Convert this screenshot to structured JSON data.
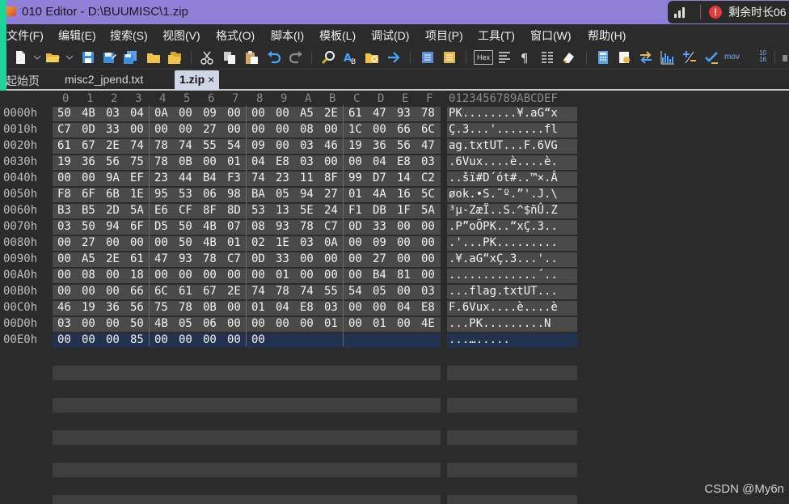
{
  "window": {
    "title": "010 Editor - D:\\BUUMISC\\1.zip",
    "timer_text": "剩余时长06"
  },
  "menu": [
    "文件(F)",
    "编辑(E)",
    "搜索(S)",
    "视图(V)",
    "格式(O)",
    "脚本(I)",
    "模板(L)",
    "调试(D)",
    "项目(P)",
    "工具(T)",
    "窗口(W)",
    "帮助(H)"
  ],
  "toolbar": {
    "hex_label": "Hex",
    "mov_label": "mov",
    "num_label": "10 16",
    "icons": [
      "new-file-icon",
      "open-folder-icon",
      "save-icon",
      "save-as-icon",
      "save-all-icon",
      "open-folder-icon-2",
      "folder-icon",
      "cut-icon",
      "copy-icon",
      "paste-icon",
      "undo-icon",
      "redo-icon",
      "find-icon",
      "replace-icon",
      "find-in-files-icon",
      "goto-icon",
      "bookmark-icon",
      "highlight-icon",
      "hex-view-icon",
      "text-format-icon",
      "pilcrow-icon",
      "columns-icon",
      "eraser-icon",
      "calculator-icon",
      "template-icon",
      "swap-icon",
      "histogram-icon",
      "plus-minus-icon",
      "checksum-icon",
      "mov-icon",
      "base-convert-icon"
    ]
  },
  "tabs": [
    {
      "label": "起始页",
      "active": false
    },
    {
      "label": "misc2_jpend.txt",
      "active": false
    },
    {
      "label": "1.zip",
      "active": true,
      "close": "×"
    }
  ],
  "hex_editor": {
    "column_headers": [
      "0",
      "1",
      "2",
      "3",
      "4",
      "5",
      "6",
      "7",
      "8",
      "9",
      "A",
      "B",
      "C",
      "D",
      "E",
      "F"
    ],
    "ascii_header": "0123456789ABCDEF",
    "rows": [
      {
        "addr": "0000h",
        "bytes": [
          "50",
          "4B",
          "03",
          "04",
          "0A",
          "00",
          "09",
          "00",
          "00",
          "00",
          "A5",
          "2E",
          "61",
          "47",
          "93",
          "78"
        ],
        "ascii": "PK........¥.aG“x"
      },
      {
        "addr": "0010h",
        "bytes": [
          "C7",
          "0D",
          "33",
          "00",
          "00",
          "00",
          "27",
          "00",
          "00",
          "00",
          "08",
          "00",
          "1C",
          "00",
          "66",
          "6C"
        ],
        "ascii": "Ç.3...'.......fl"
      },
      {
        "addr": "0020h",
        "bytes": [
          "61",
          "67",
          "2E",
          "74",
          "78",
          "74",
          "55",
          "54",
          "09",
          "00",
          "03",
          "46",
          "19",
          "36",
          "56",
          "47"
        ],
        "ascii": "ag.txtUT...F.6VG"
      },
      {
        "addr": "0030h",
        "bytes": [
          "19",
          "36",
          "56",
          "75",
          "78",
          "0B",
          "00",
          "01",
          "04",
          "E8",
          "03",
          "00",
          "00",
          "04",
          "E8",
          "03"
        ],
        "ascii": ".6Vux....è....è."
      },
      {
        "addr": "0040h",
        "bytes": [
          "00",
          "00",
          "9A",
          "EF",
          "23",
          "44",
          "B4",
          "F3",
          "74",
          "23",
          "11",
          "8F",
          "99",
          "D7",
          "14",
          "C2"
        ],
        "ascii": "..šï#D´ót#..™×.Â"
      },
      {
        "addr": "0050h",
        "bytes": [
          "F8",
          "6F",
          "6B",
          "1E",
          "95",
          "53",
          "06",
          "98",
          "BA",
          "05",
          "94",
          "27",
          "01",
          "4A",
          "16",
          "5C"
        ],
        "ascii": "øok.•S.˜º.”'.J.\\"
      },
      {
        "addr": "0060h",
        "bytes": [
          "B3",
          "B5",
          "2D",
          "5A",
          "E6",
          "CF",
          "8F",
          "8D",
          "53",
          "13",
          "5E",
          "24",
          "F1",
          "DB",
          "1F",
          "5A"
        ],
        "ascii": "³µ-ZæÏ..S.^$ñÛ.Z"
      },
      {
        "addr": "0070h",
        "bytes": [
          "03",
          "50",
          "94",
          "6F",
          "D5",
          "50",
          "4B",
          "07",
          "08",
          "93",
          "78",
          "C7",
          "0D",
          "33",
          "00",
          "00"
        ],
        "ascii": ".P”oÕPK..“xÇ.3.."
      },
      {
        "addr": "0080h",
        "bytes": [
          "00",
          "27",
          "00",
          "00",
          "00",
          "50",
          "4B",
          "01",
          "02",
          "1E",
          "03",
          "0A",
          "00",
          "09",
          "00",
          "00"
        ],
        "ascii": ".'...PK........."
      },
      {
        "addr": "0090h",
        "bytes": [
          "00",
          "A5",
          "2E",
          "61",
          "47",
          "93",
          "78",
          "C7",
          "0D",
          "33",
          "00",
          "00",
          "00",
          "27",
          "00",
          "00"
        ],
        "ascii": ".¥.aG“xÇ.3...'.."
      },
      {
        "addr": "00A0h",
        "bytes": [
          "00",
          "08",
          "00",
          "18",
          "00",
          "00",
          "00",
          "00",
          "00",
          "01",
          "00",
          "00",
          "00",
          "B4",
          "81",
          "00"
        ],
        "ascii": ".............´.."
      },
      {
        "addr": "00B0h",
        "bytes": [
          "00",
          "00",
          "00",
          "66",
          "6C",
          "61",
          "67",
          "2E",
          "74",
          "78",
          "74",
          "55",
          "54",
          "05",
          "00",
          "03"
        ],
        "ascii": "...flag.txtUT..."
      },
      {
        "addr": "00C0h",
        "bytes": [
          "46",
          "19",
          "36",
          "56",
          "75",
          "78",
          "0B",
          "00",
          "01",
          "04",
          "E8",
          "03",
          "00",
          "00",
          "04",
          "E8"
        ],
        "ascii": "F.6Vux....è....è"
      },
      {
        "addr": "00D0h",
        "bytes": [
          "03",
          "00",
          "00",
          "50",
          "4B",
          "05",
          "06",
          "00",
          "00",
          "00",
          "00",
          "01",
          "00",
          "01",
          "00",
          "4E"
        ],
        "ascii": "...PK.........N"
      },
      {
        "addr": "00E0h",
        "bytes": [
          "00",
          "00",
          "00",
          "85",
          "00",
          "00",
          "00",
          "00",
          "00"
        ],
        "ascii": "...…....."
      }
    ]
  },
  "watermark": "CSDN @My6n",
  "colors": {
    "titlebar": "#8f7fd6",
    "accent_green": "#1fd39b",
    "row_bg": "#4a4a4a",
    "highlight_row": "#23324f",
    "active_tab": "#cfd6e6"
  }
}
